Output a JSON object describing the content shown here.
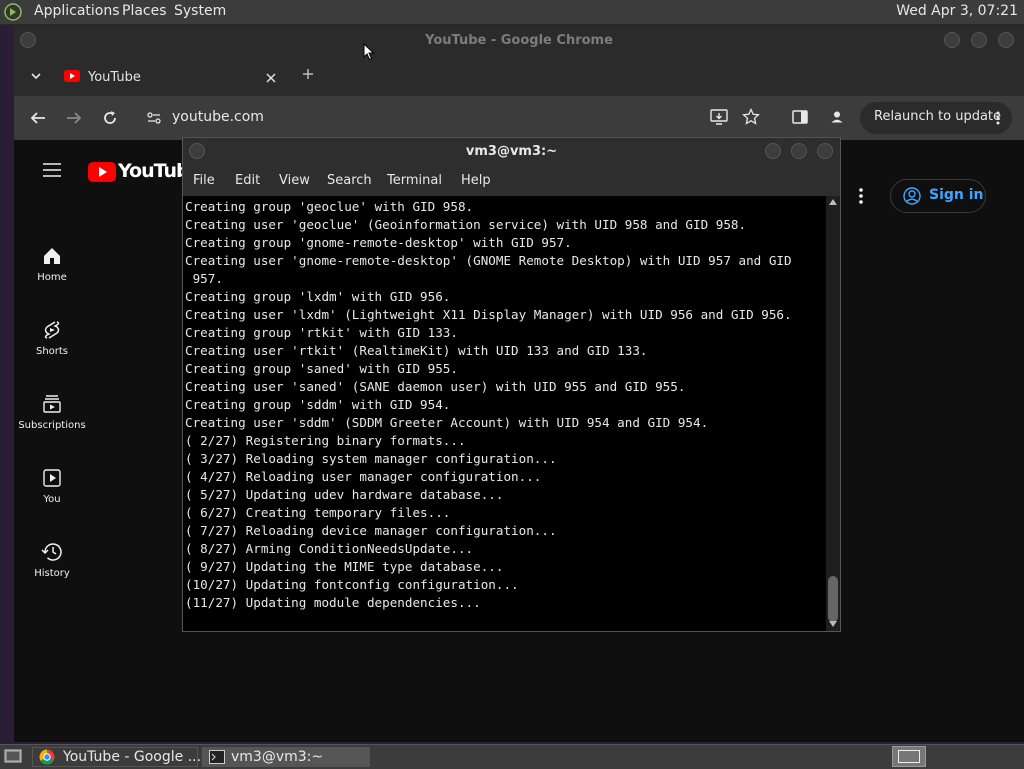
{
  "top_panel": {
    "menus": [
      "Applications",
      "Places",
      "System"
    ],
    "clock": "Wed Apr  3, 07:21"
  },
  "chrome": {
    "window_title": "YouTube - Google Chrome",
    "tab": {
      "title": "YouTube"
    },
    "omnibox": {
      "url": "youtube.com"
    },
    "relaunch_label": "Relaunch to update"
  },
  "youtube": {
    "logo_text": "YouTube",
    "nav": [
      {
        "label": "Home",
        "icon": "home-icon"
      },
      {
        "label": "Shorts",
        "icon": "shorts-icon"
      },
      {
        "label": "Subscriptions",
        "icon": "subscriptions-icon"
      },
      {
        "label": "You",
        "icon": "you-icon"
      },
      {
        "label": "History",
        "icon": "history-icon"
      }
    ],
    "sign_in_label": "Sign in",
    "accent_color": "#3ea6ff",
    "brand_red": "#ff0000"
  },
  "terminal": {
    "window_title": "vm3@vm3:~",
    "menus": [
      "File",
      "Edit",
      "View",
      "Search",
      "Terminal",
      "Help"
    ],
    "lines": [
      "Creating group 'geoclue' with GID 958.",
      "Creating user 'geoclue' (Geoinformation service) with UID 958 and GID 958.",
      "Creating group 'gnome-remote-desktop' with GID 957.",
      "Creating user 'gnome-remote-desktop' (GNOME Remote Desktop) with UID 957 and GID",
      " 957.",
      "Creating group 'lxdm' with GID 956.",
      "Creating user 'lxdm' (Lightweight X11 Display Manager) with UID 956 and GID 956.",
      "Creating group 'rtkit' with GID 133.",
      "Creating user 'rtkit' (RealtimeKit) with UID 133 and GID 133.",
      "Creating group 'saned' with GID 955.",
      "Creating user 'saned' (SANE daemon user) with UID 955 and GID 955.",
      "Creating group 'sddm' with GID 954.",
      "Creating user 'sddm' (SDDM Greeter Account) with UID 954 and GID 954.",
      "( 2/27) Registering binary formats...",
      "( 3/27) Reloading system manager configuration...",
      "( 4/27) Reloading user manager configuration...",
      "( 5/27) Updating udev hardware database...",
      "( 6/27) Creating temporary files...",
      "( 7/27) Reloading device manager configuration...",
      "( 8/27) Arming ConditionNeedsUpdate...",
      "( 9/27) Updating the MIME type database...",
      "(10/27) Updating fontconfig configuration...",
      "(11/27) Updating module dependencies..."
    ]
  },
  "taskbar": {
    "tasks": [
      {
        "label": "YouTube - Google ...",
        "icon": "chrome-icon"
      },
      {
        "label": "vm3@vm3:~",
        "icon": "terminal-icon"
      }
    ]
  }
}
